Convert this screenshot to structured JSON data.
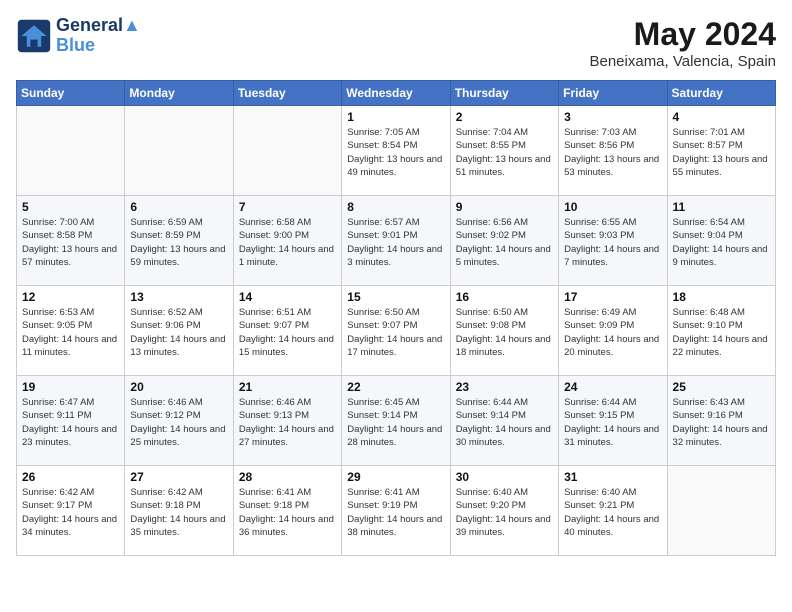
{
  "header": {
    "logo_line1": "General",
    "logo_line2": "Blue",
    "month": "May 2024",
    "location": "Beneixama, Valencia, Spain"
  },
  "days_of_week": [
    "Sunday",
    "Monday",
    "Tuesday",
    "Wednesday",
    "Thursday",
    "Friday",
    "Saturday"
  ],
  "weeks": [
    [
      {
        "day": "",
        "sunrise": "",
        "sunset": "",
        "daylight": ""
      },
      {
        "day": "",
        "sunrise": "",
        "sunset": "",
        "daylight": ""
      },
      {
        "day": "",
        "sunrise": "",
        "sunset": "",
        "daylight": ""
      },
      {
        "day": "1",
        "sunrise": "7:05 AM",
        "sunset": "8:54 PM",
        "daylight": "13 hours and 49 minutes."
      },
      {
        "day": "2",
        "sunrise": "7:04 AM",
        "sunset": "8:55 PM",
        "daylight": "13 hours and 51 minutes."
      },
      {
        "day": "3",
        "sunrise": "7:03 AM",
        "sunset": "8:56 PM",
        "daylight": "13 hours and 53 minutes."
      },
      {
        "day": "4",
        "sunrise": "7:01 AM",
        "sunset": "8:57 PM",
        "daylight": "13 hours and 55 minutes."
      }
    ],
    [
      {
        "day": "5",
        "sunrise": "7:00 AM",
        "sunset": "8:58 PM",
        "daylight": "13 hours and 57 minutes."
      },
      {
        "day": "6",
        "sunrise": "6:59 AM",
        "sunset": "8:59 PM",
        "daylight": "13 hours and 59 minutes."
      },
      {
        "day": "7",
        "sunrise": "6:58 AM",
        "sunset": "9:00 PM",
        "daylight": "14 hours and 1 minute."
      },
      {
        "day": "8",
        "sunrise": "6:57 AM",
        "sunset": "9:01 PM",
        "daylight": "14 hours and 3 minutes."
      },
      {
        "day": "9",
        "sunrise": "6:56 AM",
        "sunset": "9:02 PM",
        "daylight": "14 hours and 5 minutes."
      },
      {
        "day": "10",
        "sunrise": "6:55 AM",
        "sunset": "9:03 PM",
        "daylight": "14 hours and 7 minutes."
      },
      {
        "day": "11",
        "sunrise": "6:54 AM",
        "sunset": "9:04 PM",
        "daylight": "14 hours and 9 minutes."
      }
    ],
    [
      {
        "day": "12",
        "sunrise": "6:53 AM",
        "sunset": "9:05 PM",
        "daylight": "14 hours and 11 minutes."
      },
      {
        "day": "13",
        "sunrise": "6:52 AM",
        "sunset": "9:06 PM",
        "daylight": "14 hours and 13 minutes."
      },
      {
        "day": "14",
        "sunrise": "6:51 AM",
        "sunset": "9:07 PM",
        "daylight": "14 hours and 15 minutes."
      },
      {
        "day": "15",
        "sunrise": "6:50 AM",
        "sunset": "9:07 PM",
        "daylight": "14 hours and 17 minutes."
      },
      {
        "day": "16",
        "sunrise": "6:50 AM",
        "sunset": "9:08 PM",
        "daylight": "14 hours and 18 minutes."
      },
      {
        "day": "17",
        "sunrise": "6:49 AM",
        "sunset": "9:09 PM",
        "daylight": "14 hours and 20 minutes."
      },
      {
        "day": "18",
        "sunrise": "6:48 AM",
        "sunset": "9:10 PM",
        "daylight": "14 hours and 22 minutes."
      }
    ],
    [
      {
        "day": "19",
        "sunrise": "6:47 AM",
        "sunset": "9:11 PM",
        "daylight": "14 hours and 23 minutes."
      },
      {
        "day": "20",
        "sunrise": "6:46 AM",
        "sunset": "9:12 PM",
        "daylight": "14 hours and 25 minutes."
      },
      {
        "day": "21",
        "sunrise": "6:46 AM",
        "sunset": "9:13 PM",
        "daylight": "14 hours and 27 minutes."
      },
      {
        "day": "22",
        "sunrise": "6:45 AM",
        "sunset": "9:14 PM",
        "daylight": "14 hours and 28 minutes."
      },
      {
        "day": "23",
        "sunrise": "6:44 AM",
        "sunset": "9:14 PM",
        "daylight": "14 hours and 30 minutes."
      },
      {
        "day": "24",
        "sunrise": "6:44 AM",
        "sunset": "9:15 PM",
        "daylight": "14 hours and 31 minutes."
      },
      {
        "day": "25",
        "sunrise": "6:43 AM",
        "sunset": "9:16 PM",
        "daylight": "14 hours and 32 minutes."
      }
    ],
    [
      {
        "day": "26",
        "sunrise": "6:42 AM",
        "sunset": "9:17 PM",
        "daylight": "14 hours and 34 minutes."
      },
      {
        "day": "27",
        "sunrise": "6:42 AM",
        "sunset": "9:18 PM",
        "daylight": "14 hours and 35 minutes."
      },
      {
        "day": "28",
        "sunrise": "6:41 AM",
        "sunset": "9:18 PM",
        "daylight": "14 hours and 36 minutes."
      },
      {
        "day": "29",
        "sunrise": "6:41 AM",
        "sunset": "9:19 PM",
        "daylight": "14 hours and 38 minutes."
      },
      {
        "day": "30",
        "sunrise": "6:40 AM",
        "sunset": "9:20 PM",
        "daylight": "14 hours and 39 minutes."
      },
      {
        "day": "31",
        "sunrise": "6:40 AM",
        "sunset": "9:21 PM",
        "daylight": "14 hours and 40 minutes."
      },
      {
        "day": "",
        "sunrise": "",
        "sunset": "",
        "daylight": ""
      }
    ]
  ]
}
